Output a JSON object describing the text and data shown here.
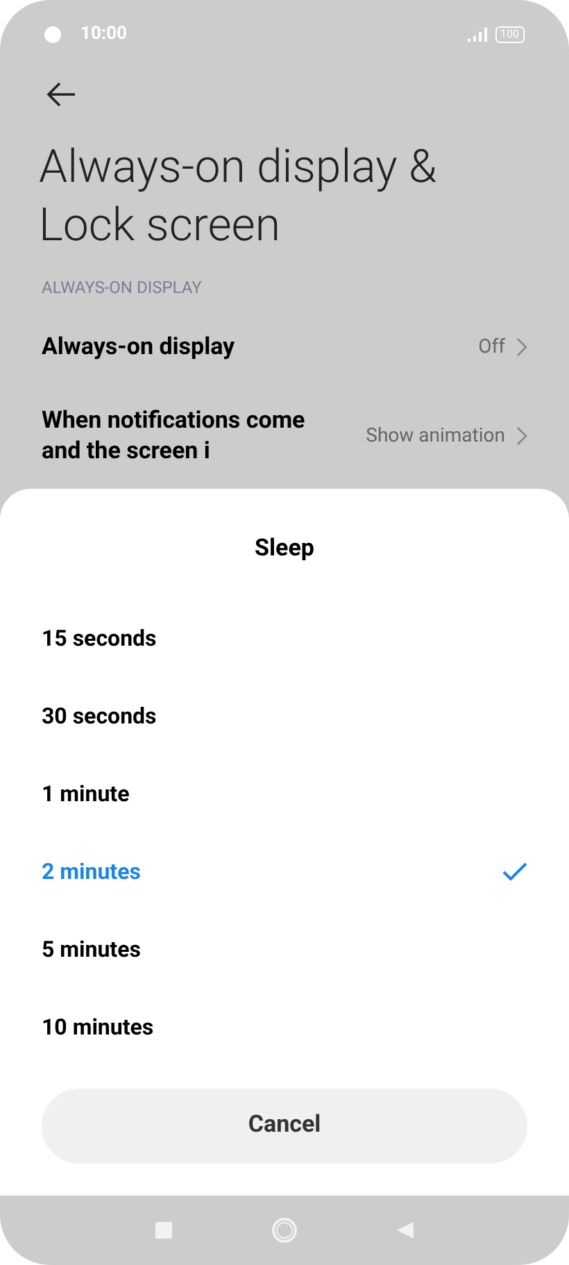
{
  "status_bar": {
    "time": "10:00",
    "battery": "100"
  },
  "header": {
    "title": "Always-on display & Lock screen"
  },
  "section": {
    "label": "ALWAYS-ON DISPLAY"
  },
  "settings": [
    {
      "title": "Always-on display",
      "value": "Off"
    },
    {
      "title": "When notifications come and the screen i",
      "value": "Show animation"
    }
  ],
  "sheet": {
    "title": "Sleep",
    "options": [
      {
        "label": "15 seconds",
        "selected": false
      },
      {
        "label": "30 seconds",
        "selected": false
      },
      {
        "label": "1 minute",
        "selected": false
      },
      {
        "label": "2 minutes",
        "selected": true
      },
      {
        "label": "5 minutes",
        "selected": false
      },
      {
        "label": "10 minutes",
        "selected": false
      }
    ],
    "cancel": "Cancel"
  }
}
